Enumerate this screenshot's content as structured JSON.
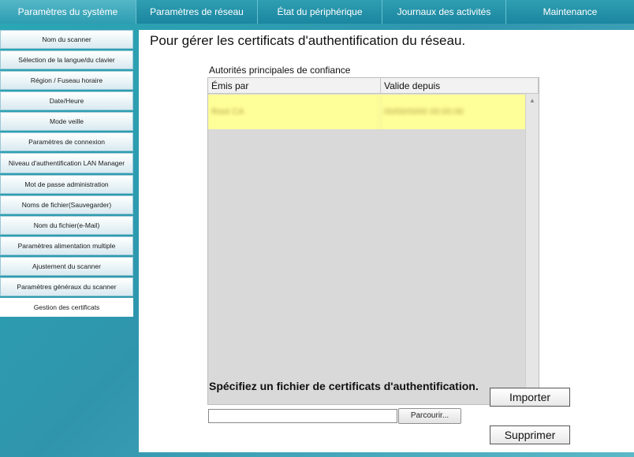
{
  "tabs": [
    {
      "label": "Paramètres du système",
      "active": true
    },
    {
      "label": "Paramètres de réseau",
      "active": false
    },
    {
      "label": "État du périphérique",
      "active": false
    },
    {
      "label": "Journaux des activités",
      "active": false
    },
    {
      "label": "Maintenance",
      "active": false
    }
  ],
  "sidebar": {
    "items": [
      {
        "label": "Nom du scanner"
      },
      {
        "label": "Sélection de la langue/du clavier"
      },
      {
        "label": "Région / Fuseau horaire"
      },
      {
        "label": "Date/Heure"
      },
      {
        "label": "Mode veille"
      },
      {
        "label": "Paramètres de connexion"
      },
      {
        "label": "Niveau d'authentification LAN Manager"
      },
      {
        "label": "Mot de passe administration"
      },
      {
        "label": "Noms de fichier(Sauvegarder)"
      },
      {
        "label": "Nom du fichier(e-Mail)"
      },
      {
        "label": "Paramètres alimentation multiple"
      },
      {
        "label": "Ajustement du scanner"
      },
      {
        "label": "Paramètres généraux du scanner"
      },
      {
        "label": "Gestion des certificats",
        "active": true
      }
    ]
  },
  "main": {
    "title": "Pour gérer les certificats d'authentification du réseau.",
    "table_label": "Autorités principales de confiance",
    "columns": [
      "Émis par",
      "Valide depuis"
    ],
    "rows": [
      {
        "issued_by": "Root CA",
        "valid_from": "00/00/0000 00:00:00"
      }
    ],
    "specify_label": "Spécifiez un fichier de certificats d'authentification.",
    "file_value": "",
    "browse_label": "Parcourir...",
    "import_label": "Importer",
    "delete_label": "Supprimer"
  },
  "colors": {
    "tab_bg": "#1b86a0",
    "selected_row": "#ffff99",
    "table_bg": "#d9d9d9"
  }
}
